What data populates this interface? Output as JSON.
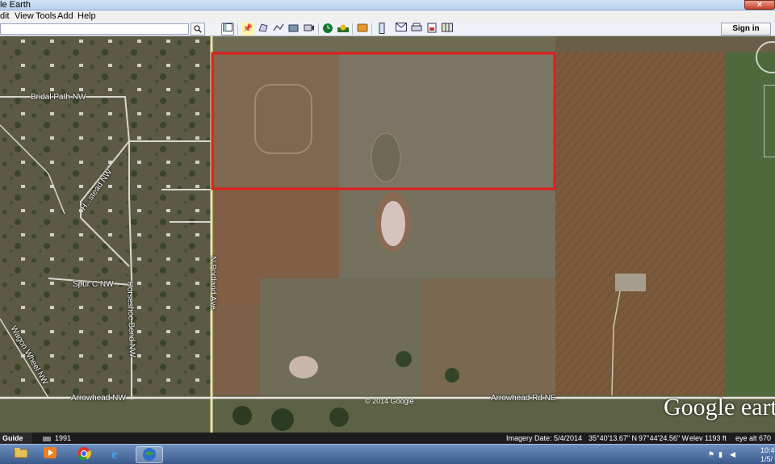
{
  "window": {
    "title": "le Earth",
    "close_label": "✕"
  },
  "menu": {
    "items": [
      "dit",
      "View",
      "Tools",
      "Add",
      "Help"
    ]
  },
  "toolbar": {
    "search_value": "",
    "search_icon": "magnifier-icon",
    "sign_in_label": "Sign in",
    "buttons": [
      "sidebar-toggle-icon",
      "placemark-icon",
      "polygon-icon",
      "path-icon",
      "image-overlay-icon",
      "record-tour-icon",
      "historical-imagery-icon",
      "sunlight-icon",
      "planets-icon",
      "ruler-icon",
      "email-icon",
      "print-icon",
      "save-image-icon",
      "view-in-maps-icon"
    ]
  },
  "map": {
    "road_labels": {
      "bridal_path": "Bridal Path NW",
      "homestead": "H...stead NW",
      "spur_c": "Spur C NW",
      "horseshoe_bend": "Horseshoe Bend NW",
      "wagon_wheel": "Wagon Wheel NW",
      "n_portland": "N Portland Ave",
      "arrowhead_nw": "Arrowhead NW",
      "arrowhead_rd_ne": "Arrowhead Rd NE"
    },
    "copyright": "© 2014 Google",
    "brand": "Google earth",
    "highlight_color": "#e21d1d"
  },
  "status": {
    "guide_label": "Guide",
    "year_label": "1991",
    "imagery_date": "Imagery Date: 5/4/2014",
    "lat": "35°40'13.67\" N",
    "lon": "97°44'24.56\" W",
    "elev": "elev  1193 ft",
    "eye_alt": "eye alt  670"
  },
  "taskbar": {
    "clock_time": "10:43",
    "clock_date": "1/5/",
    "apps": [
      "folder-icon",
      "media-player-icon",
      "chrome-icon",
      "internet-explorer-icon",
      "google-earth-icon"
    ]
  }
}
